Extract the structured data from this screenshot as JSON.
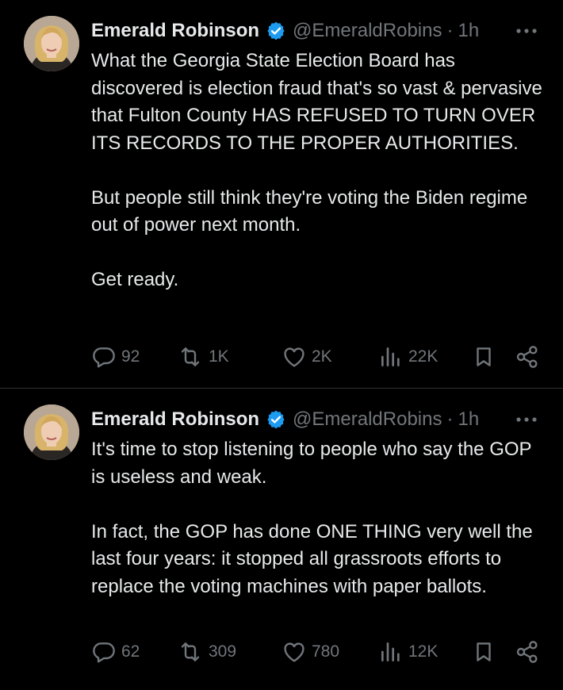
{
  "colors": {
    "background": "#000000",
    "text": "#e7e9ea",
    "secondary": "#71767b",
    "verified": "#1d9bf0",
    "divider": "#2f3336"
  },
  "icons": {
    "reply": "reply-icon",
    "retweet": "retweet-icon",
    "like": "heart-icon",
    "views": "views-icon",
    "bookmark": "bookmark-icon",
    "share": "share-icon",
    "more": "more-icon",
    "verified": "verified-badge-icon"
  },
  "tweets": [
    {
      "author": "Emerald Robinson",
      "handle": "@EmeraldRobins",
      "separator": "·",
      "time": "1h",
      "paragraphs": [
        "What the Georgia State Election Board has discovered is election fraud that's so vast & pervasive that Fulton County HAS REFUSED TO TURN OVER ITS RECORDS TO THE PROPER AUTHORITIES.",
        "But people still think they're voting the Biden regime out of power next month.",
        "Get ready."
      ],
      "stats": {
        "replies": "92",
        "reposts": "1K",
        "likes": "2K",
        "views": "22K"
      }
    },
    {
      "author": "Emerald Robinson",
      "handle": "@EmeraldRobins",
      "separator": "·",
      "time": "1h",
      "paragraphs": [
        "It's time to stop listening to people who say the GOP is useless and weak.",
        "In fact, the GOP has done ONE THING very well the last four years: it stopped all grassroots efforts to replace the voting machines with paper ballots."
      ],
      "stats": {
        "replies": "62",
        "reposts": "309",
        "likes": "780",
        "views": "12K"
      }
    }
  ]
}
